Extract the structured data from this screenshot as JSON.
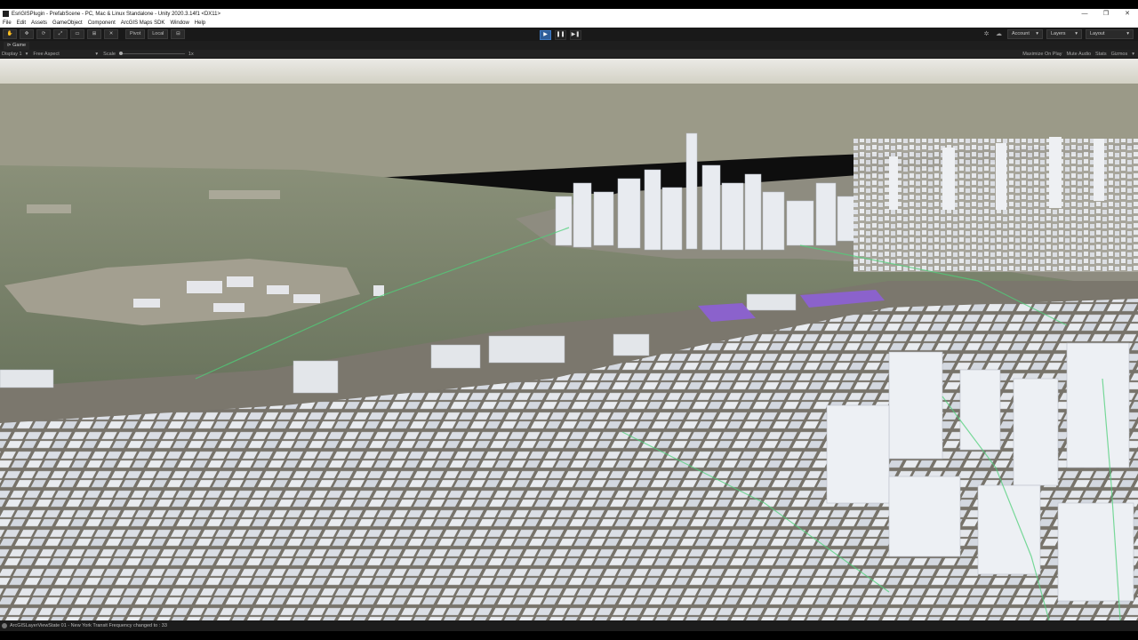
{
  "window": {
    "title": "EsriGISPlugin - PrefabScene - PC, Mac & Linux Standalone - Unity 2020.3.14f1 <DX11>",
    "controls": [
      "—",
      "❐",
      "✕"
    ]
  },
  "menu": [
    "File",
    "Edit",
    "Assets",
    "GameObject",
    "Component",
    "ArcGIS Maps SDK",
    "Window",
    "Help"
  ],
  "toolbar": {
    "pivot_label": "Pivot",
    "local_label": "Local",
    "play_icon": "▶",
    "pause_icon": "❚❚",
    "step_icon": "▶❚",
    "account_label": "Account",
    "layers_label": "Layers",
    "layout_label": "Layout"
  },
  "game_view": {
    "tab_label": "Game",
    "display_label": "Display 1",
    "aspect_label": "Free Aspect",
    "scale_label": "Scale",
    "scale_value": "1x",
    "maximize_label": "Maximize On Play",
    "mute_label": "Mute Audio",
    "stats_label": "Stats",
    "gizmos_label": "Gizmos"
  },
  "status": {
    "message": "ArcGISLayerViewState 01 - New York Transit Frequency changed to : 33"
  },
  "scene_colors": {
    "sky": "#d9d8cf",
    "water": "#6f7a63",
    "ground": "#8e8a7e",
    "buildings": "#e6e9ee",
    "highlight": "#8d5fd6",
    "transit": "#4fd07a"
  }
}
